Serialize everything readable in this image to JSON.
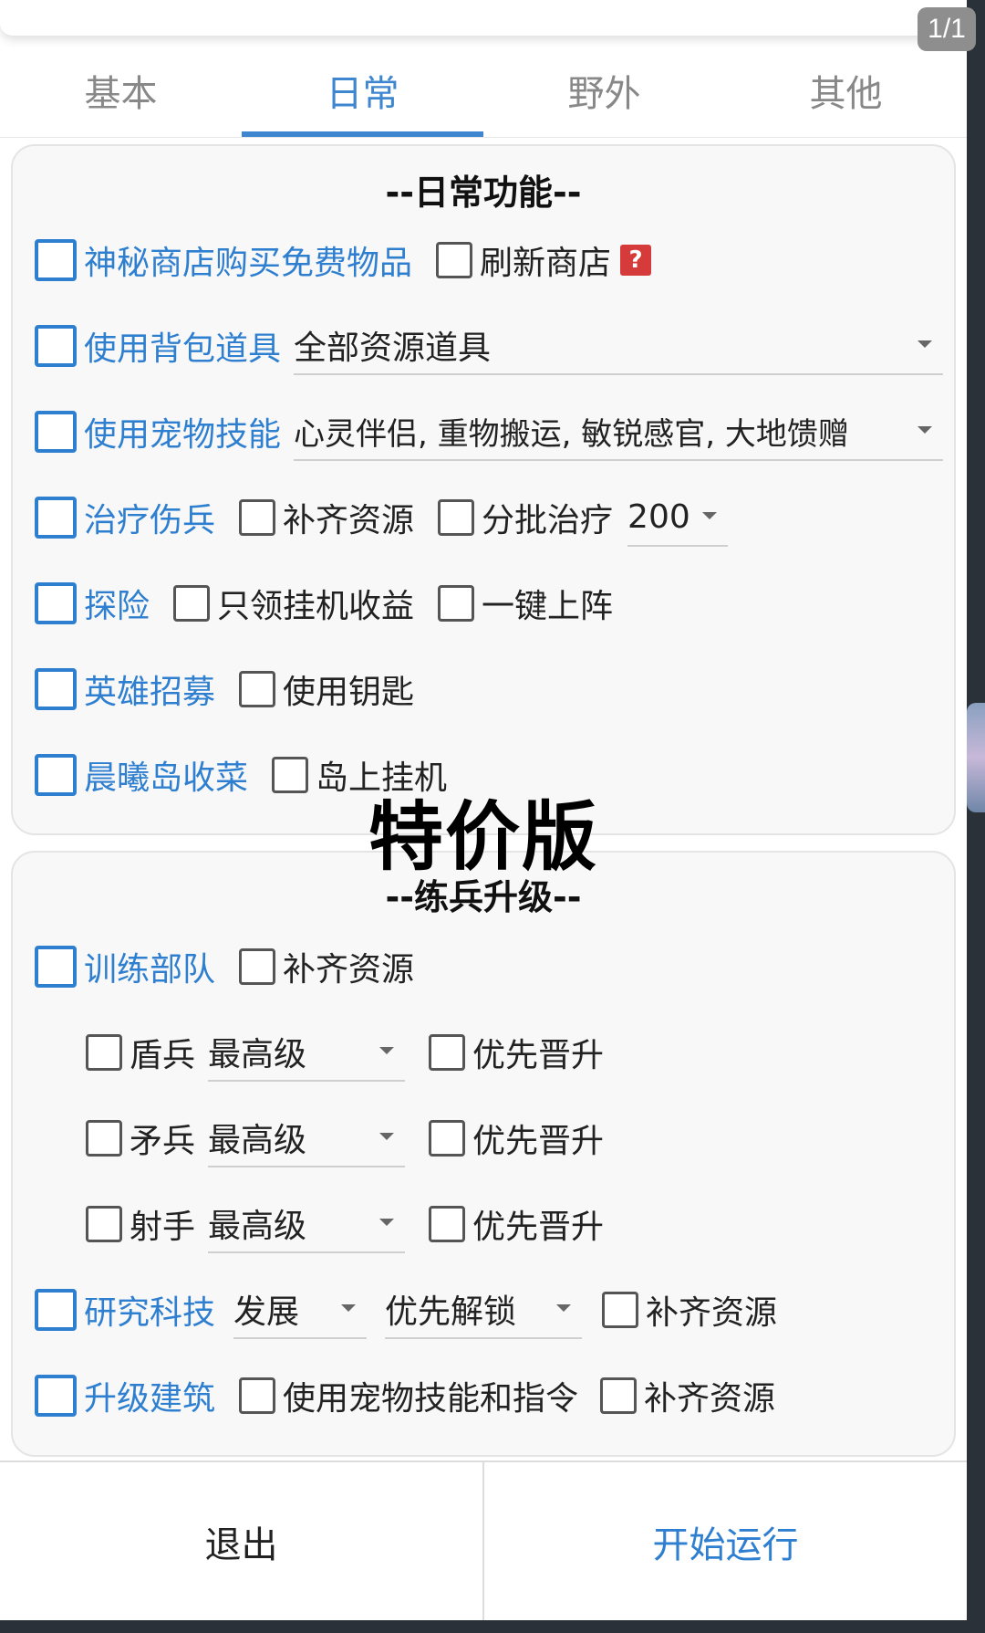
{
  "page_badge": "1/1",
  "tabs": [
    {
      "label": "基本"
    },
    {
      "label": "日常"
    },
    {
      "label": "野外"
    },
    {
      "label": "其他"
    }
  ],
  "daily": {
    "title": "--日常功能--",
    "mystery_shop": {
      "label": "神秘商店购买免费物品",
      "refresh_label": "刷新商店",
      "help": "?"
    },
    "use_bag_items": {
      "label": "使用背包道具",
      "select_value": "全部资源道具"
    },
    "use_pet_skills": {
      "label": "使用宠物技能",
      "select_value": "心灵伴侣, 重物搬运, 敏锐感官, 大地馈赠"
    },
    "heal": {
      "label": "治疗伤兵",
      "refill_label": "补齐资源",
      "batch_label": "分批治疗",
      "batch_value": "200"
    },
    "explore": {
      "label": "探险",
      "idle_label": "只领挂机收益",
      "deploy_label": "一键上阵"
    },
    "hero_recruit": {
      "label": "英雄招募",
      "key_label": "使用钥匙"
    },
    "island": {
      "label": "晨曦岛收菜",
      "idle_label": "岛上挂机"
    }
  },
  "watermark": "特价版",
  "training": {
    "title": "--练兵升级--",
    "train": {
      "label": "训练部队",
      "refill_label": "补齐资源"
    },
    "units": [
      {
        "name": "盾兵",
        "level": "最高级",
        "promote_label": "优先晋升"
      },
      {
        "name": "矛兵",
        "level": "最高级",
        "promote_label": "优先晋升"
      },
      {
        "name": "射手",
        "level": "最高级",
        "promote_label": "优先晋升"
      }
    ],
    "research": {
      "label": "研究科技",
      "select1": "发展",
      "select2": "优先解锁",
      "refill_label": "补齐资源"
    },
    "upgrade": {
      "label": "升级建筑",
      "pet_label": "使用宠物技能和指令",
      "refill_label": "补齐资源"
    }
  },
  "footer": {
    "exit_label": "退出",
    "start_label": "开始运行"
  },
  "colors": {
    "accent": "#2f7fd0",
    "help_badge": "#d63b3b"
  }
}
